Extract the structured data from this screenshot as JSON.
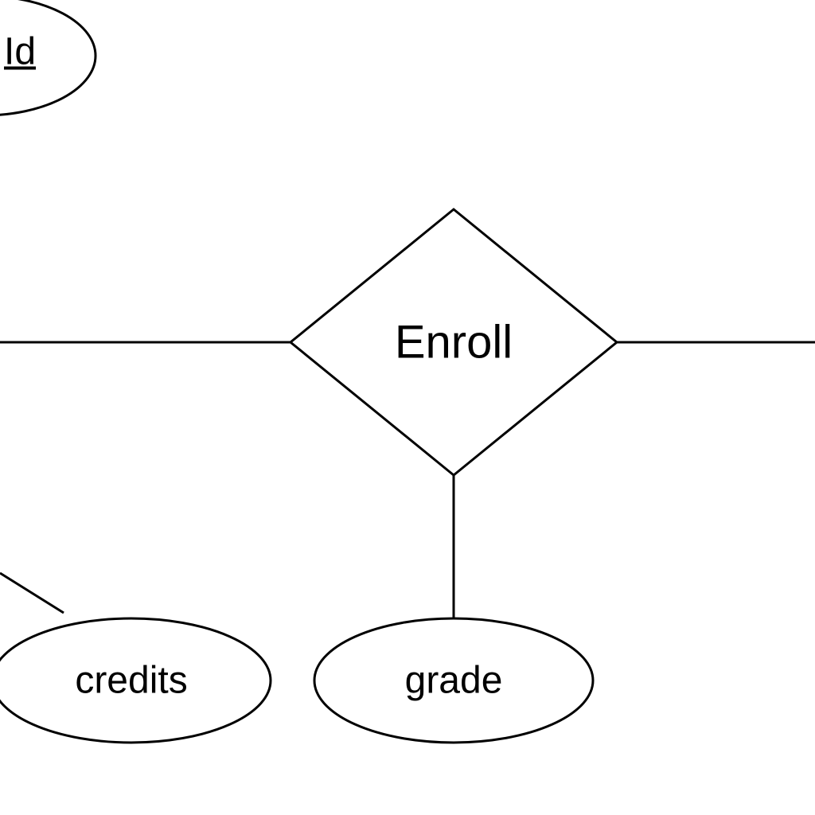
{
  "diagram": {
    "type": "entity-relationship",
    "relationship": {
      "name": "Enroll"
    },
    "attributes": {
      "topLeft": {
        "label": "Id",
        "isKey": true
      },
      "credits": {
        "label": "credits",
        "isKey": false
      },
      "grade": {
        "label": "grade",
        "isKey": false
      }
    }
  }
}
